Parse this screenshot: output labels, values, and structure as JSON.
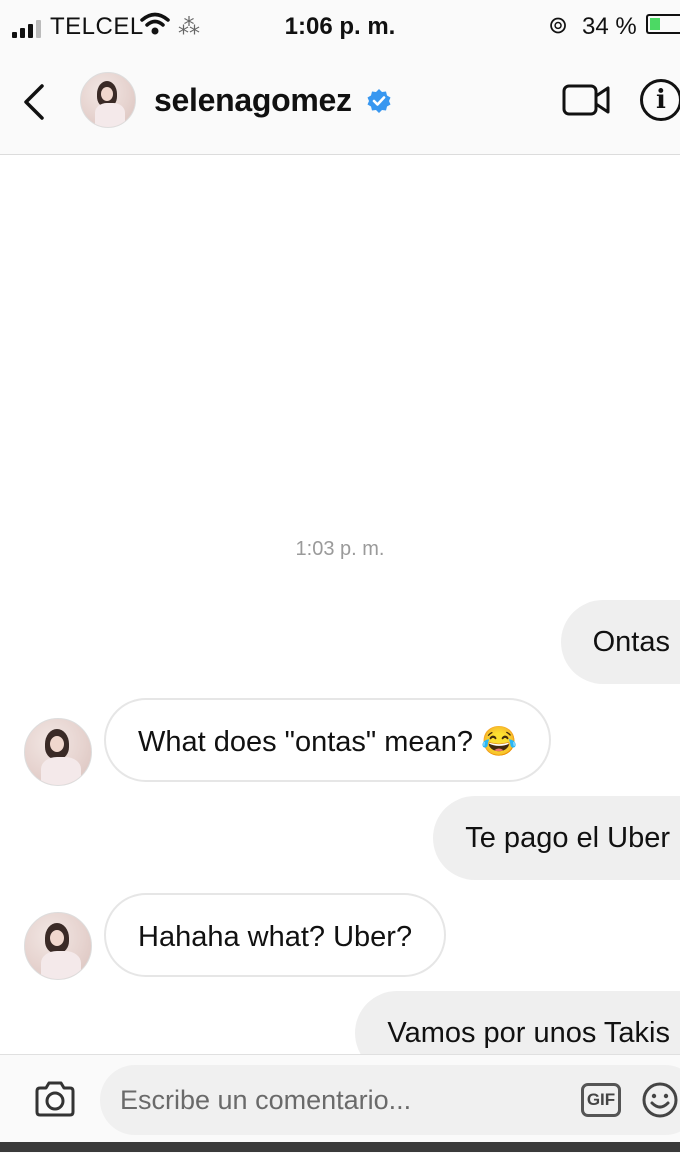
{
  "status_bar": {
    "carrier": "TELCEL",
    "time": "1:06 p. m.",
    "battery": "34 %",
    "battery_level": 0.34
  },
  "header": {
    "username": "selenagomez",
    "verified": true,
    "icons": [
      "back-chevron-icon",
      "verified-badge-icon",
      "video-call-icon",
      "info-icon"
    ]
  },
  "chat": {
    "timestamp": "1:03 p. m.",
    "messages": [
      {
        "from": "me",
        "text": "Ontas"
      },
      {
        "from": "them",
        "text": "What does \"ontas\" mean? 😂"
      },
      {
        "from": "me",
        "text": "Te pago el Uber"
      },
      {
        "from": "them",
        "text": "Hahaha what? Uber?"
      },
      {
        "from": "me",
        "text": "Vamos por unos Takis"
      }
    ]
  },
  "composer": {
    "placeholder": "Escribe un comentario...",
    "gif_label": "GIF"
  },
  "colors": {
    "outgoing_bubble": "#efefef",
    "incoming_border": "#e6e6e6",
    "verified_blue": "#3897f0",
    "battery_green": "#4cd964"
  }
}
